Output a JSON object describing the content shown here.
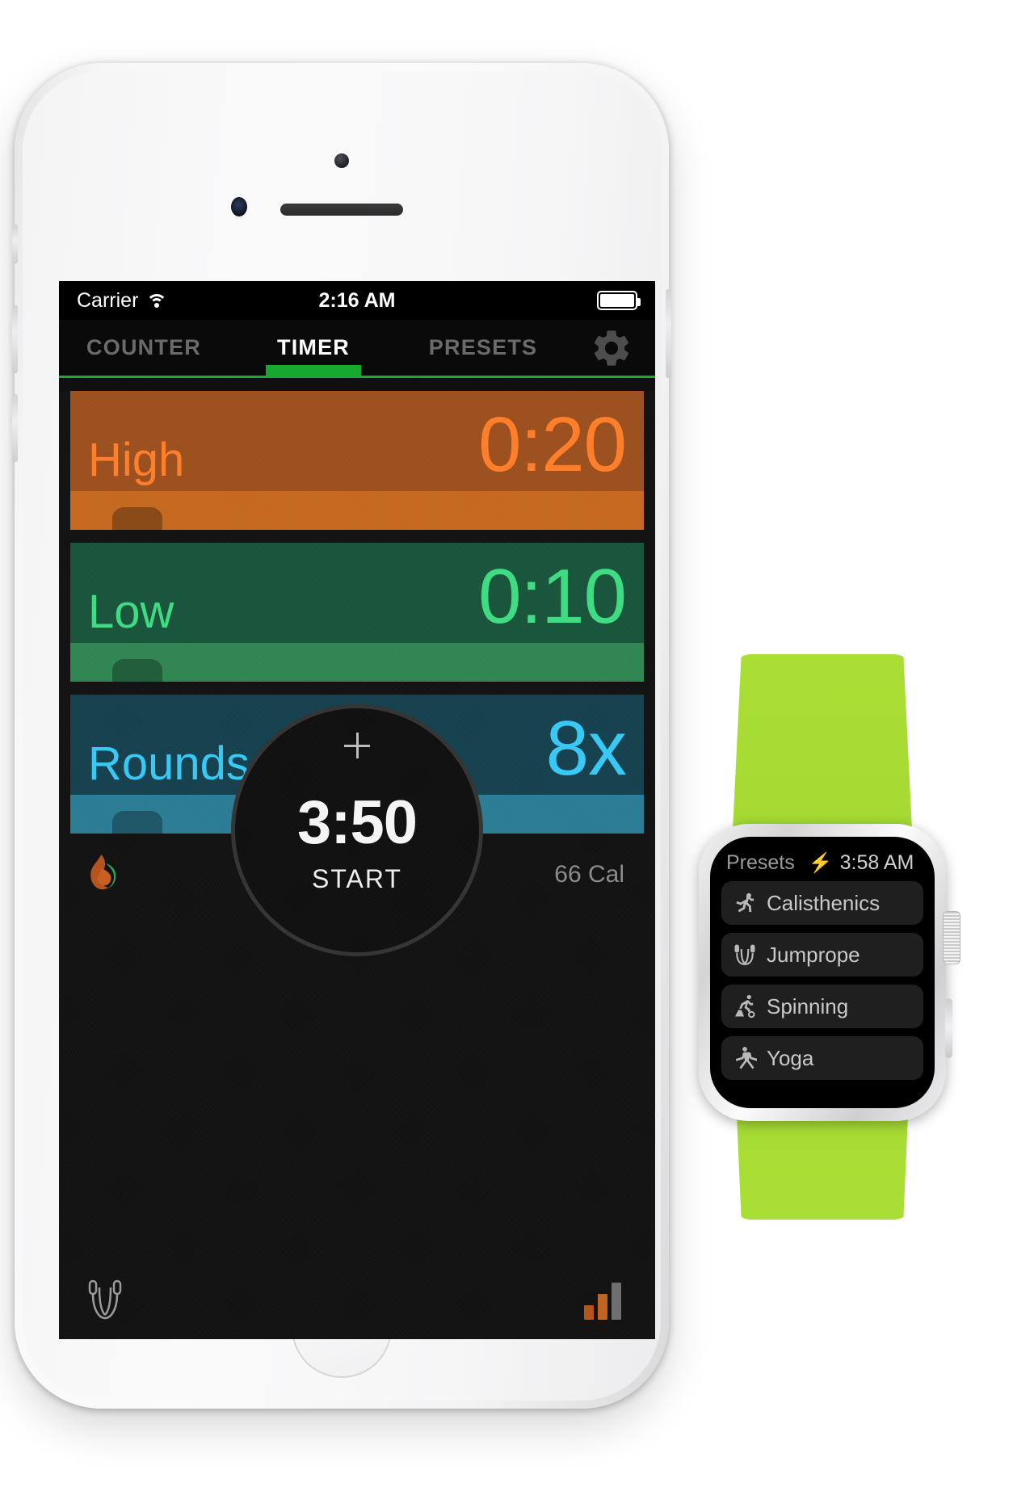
{
  "phone": {
    "statusbar": {
      "carrier": "Carrier",
      "wifi_icon": "wifi-icon",
      "time": "2:16 AM",
      "battery_icon": "battery-full-icon"
    },
    "tabs": [
      {
        "label": "COUNTER",
        "active": false
      },
      {
        "label": "TIMER",
        "active": true
      },
      {
        "label": "PRESETS",
        "active": false
      }
    ],
    "settings_icon": "gear-icon",
    "accent_green": "#17a82f",
    "intervals": [
      {
        "name": "High",
        "value": "0:20",
        "bg": "#9b4f1d",
        "fg": "#ff7d29",
        "track": "#c4681f"
      },
      {
        "name": "Low",
        "value": "0:10",
        "bg": "#17543a",
        "fg": "#3ddb82",
        "track": "#2f8552"
      },
      {
        "name": "Rounds",
        "value": "8x",
        "bg": "#14404e",
        "fg": "#36c8f5",
        "track": "#2a7b94"
      }
    ],
    "metrics": {
      "flame_icon": "flame-icon",
      "calories": "66 Cal"
    },
    "timer": {
      "add_icon": "plus-icon",
      "total": "3:50",
      "action": "START"
    },
    "footer": {
      "workout_icon": "jumprope-icon",
      "stats_icon": "bar-chart-icon"
    }
  },
  "watch": {
    "band_color": "#a8dd34",
    "header": {
      "title": "Presets",
      "charging_icon": "bolt-icon",
      "time": "3:58 AM"
    },
    "presets": [
      {
        "label": "Calisthenics",
        "icon": "calisthenics-icon"
      },
      {
        "label": "Jumprope",
        "icon": "jumprope-icon"
      },
      {
        "label": "Spinning",
        "icon": "spinning-icon"
      },
      {
        "label": "Yoga",
        "icon": "yoga-icon"
      }
    ]
  }
}
